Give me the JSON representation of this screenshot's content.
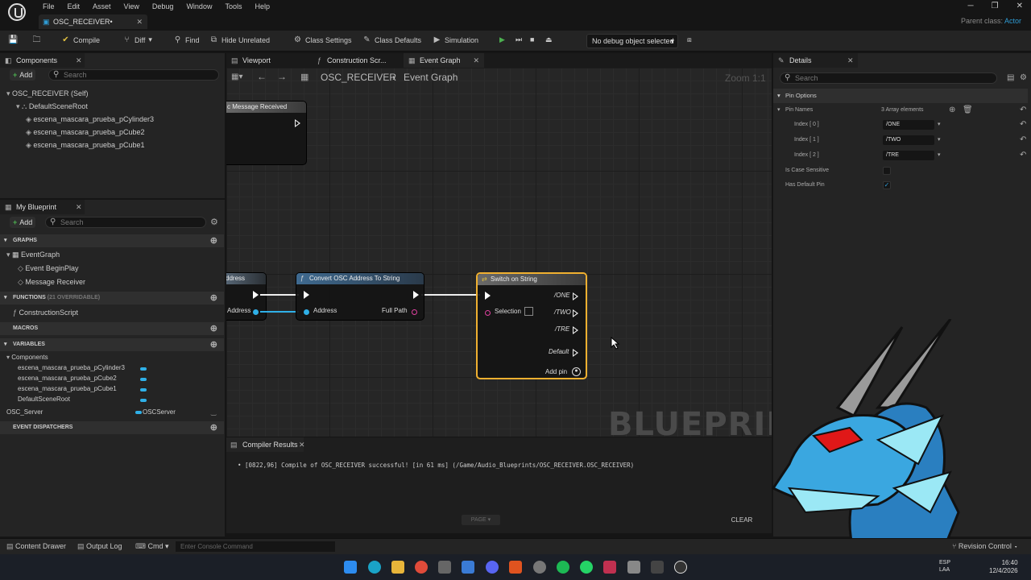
{
  "menu": [
    "File",
    "Edit",
    "Asset",
    "View",
    "Debug",
    "Window",
    "Tools",
    "Help"
  ],
  "doc_tab": "OSC_RECEIVER•",
  "window_controls": [
    "─",
    "❐",
    "✕"
  ],
  "parent_class": {
    "label": "Parent class:",
    "value": "Actor"
  },
  "toolbar": {
    "compile": "Compile",
    "diff": "Diff",
    "find": "Find",
    "hide_unrelated": "Hide Unrelated",
    "class_settings": "Class Settings",
    "class_defaults": "Class Defaults",
    "simulation": "Simulation",
    "debug_object": "No debug object selected"
  },
  "components": {
    "tab": "Components",
    "add": "Add",
    "search_placeholder": "Search",
    "items": [
      "OSC_RECEIVER (Self)",
      "DefaultSceneRoot",
      "escena_mascara_prueba_pCylinder3",
      "escena_mascara_prueba_pCube2",
      "escena_mascara_prueba_pCube1"
    ]
  },
  "my_blueprint": {
    "tab": "My Blueprint",
    "add": "Add",
    "search_placeholder": "Search",
    "graphs_header": "GRAPHS",
    "event_graph": "EventGraph",
    "graph_items": [
      "Event BeginPlay",
      "Message Receiver"
    ],
    "functions_header": "FUNCTIONS",
    "functions_overridable": "(21 OVERRIDABLE)",
    "construction_script": "ConstructionScript",
    "macros_header": "MACROS",
    "variables_header": "VARIABLES",
    "components_label": "Components",
    "variables": [
      "escena_mascara_prueba_pCylinder3",
      "escena_mascara_prueba_pCube2",
      "escena_mascara_prueba_pCube1",
      "DefaultSceneRoot"
    ],
    "osc_server_name": "OSC_Server",
    "osc_server_type": "OSCServer",
    "event_dispatchers_header": "EVENT DISPATCHERS"
  },
  "editor_tabs": [
    "Viewport",
    "Construction Scr...",
    "Event Graph"
  ],
  "breadcrumb": {
    "root": "OSC_RECEIVER",
    "sep": "›",
    "current": "Event Graph",
    "zoom": "Zoom 1:1"
  },
  "nodes": {
    "message_received": "c Message Received",
    "address_node": "ddress",
    "address_pin": "Address",
    "convert": {
      "title": "Convert OSC Address To String",
      "in": "Address",
      "out": "Full Path"
    },
    "switch": {
      "title": "Switch on String",
      "selection": "Selection",
      "pins": [
        "/ONE",
        "/TWO",
        "/TRE"
      ],
      "default": "Default",
      "add_pin": "Add pin"
    }
  },
  "watermark": "BLUEPRINT",
  "compiler": {
    "tab": "Compiler Results",
    "message": "[0822,96] Compile of OSC_RECEIVER successful! [in 61 ms] (/Game/Audio_Blueprints/OSC_RECEIVER.OSC_RECEIVER)",
    "page": "PAGE",
    "clear": "CLEAR"
  },
  "details": {
    "tab": "Details",
    "search_placeholder": "Search",
    "section": "Pin Options",
    "pin_names": "Pin Names",
    "array_count": "3 Array elements",
    "indices": [
      {
        "label": "Index [ 0 ]",
        "value": "/ONE"
      },
      {
        "label": "Index [ 1 ]",
        "value": "/TWO"
      },
      {
        "label": "Index [ 2 ]",
        "value": "/TRE"
      }
    ],
    "case_sensitive": "Is Case Sensitive",
    "case_sensitive_checked": false,
    "has_default_pin": "Has Default Pin",
    "has_default_pin_checked": true
  },
  "statusbar": {
    "content_drawer": "Content Drawer",
    "output_log": "Output Log",
    "cmd": "Cmd",
    "console_placeholder": "Enter Console Command",
    "revision": "Revision Control"
  },
  "taskbar": {
    "lang": "ESP",
    "region": "LAA",
    "time": "16:40",
    "date": "12/4/2026"
  },
  "colors": {
    "accent": "#2f9bd4",
    "switch_border": "#f0b030",
    "play": "#4caf50"
  }
}
